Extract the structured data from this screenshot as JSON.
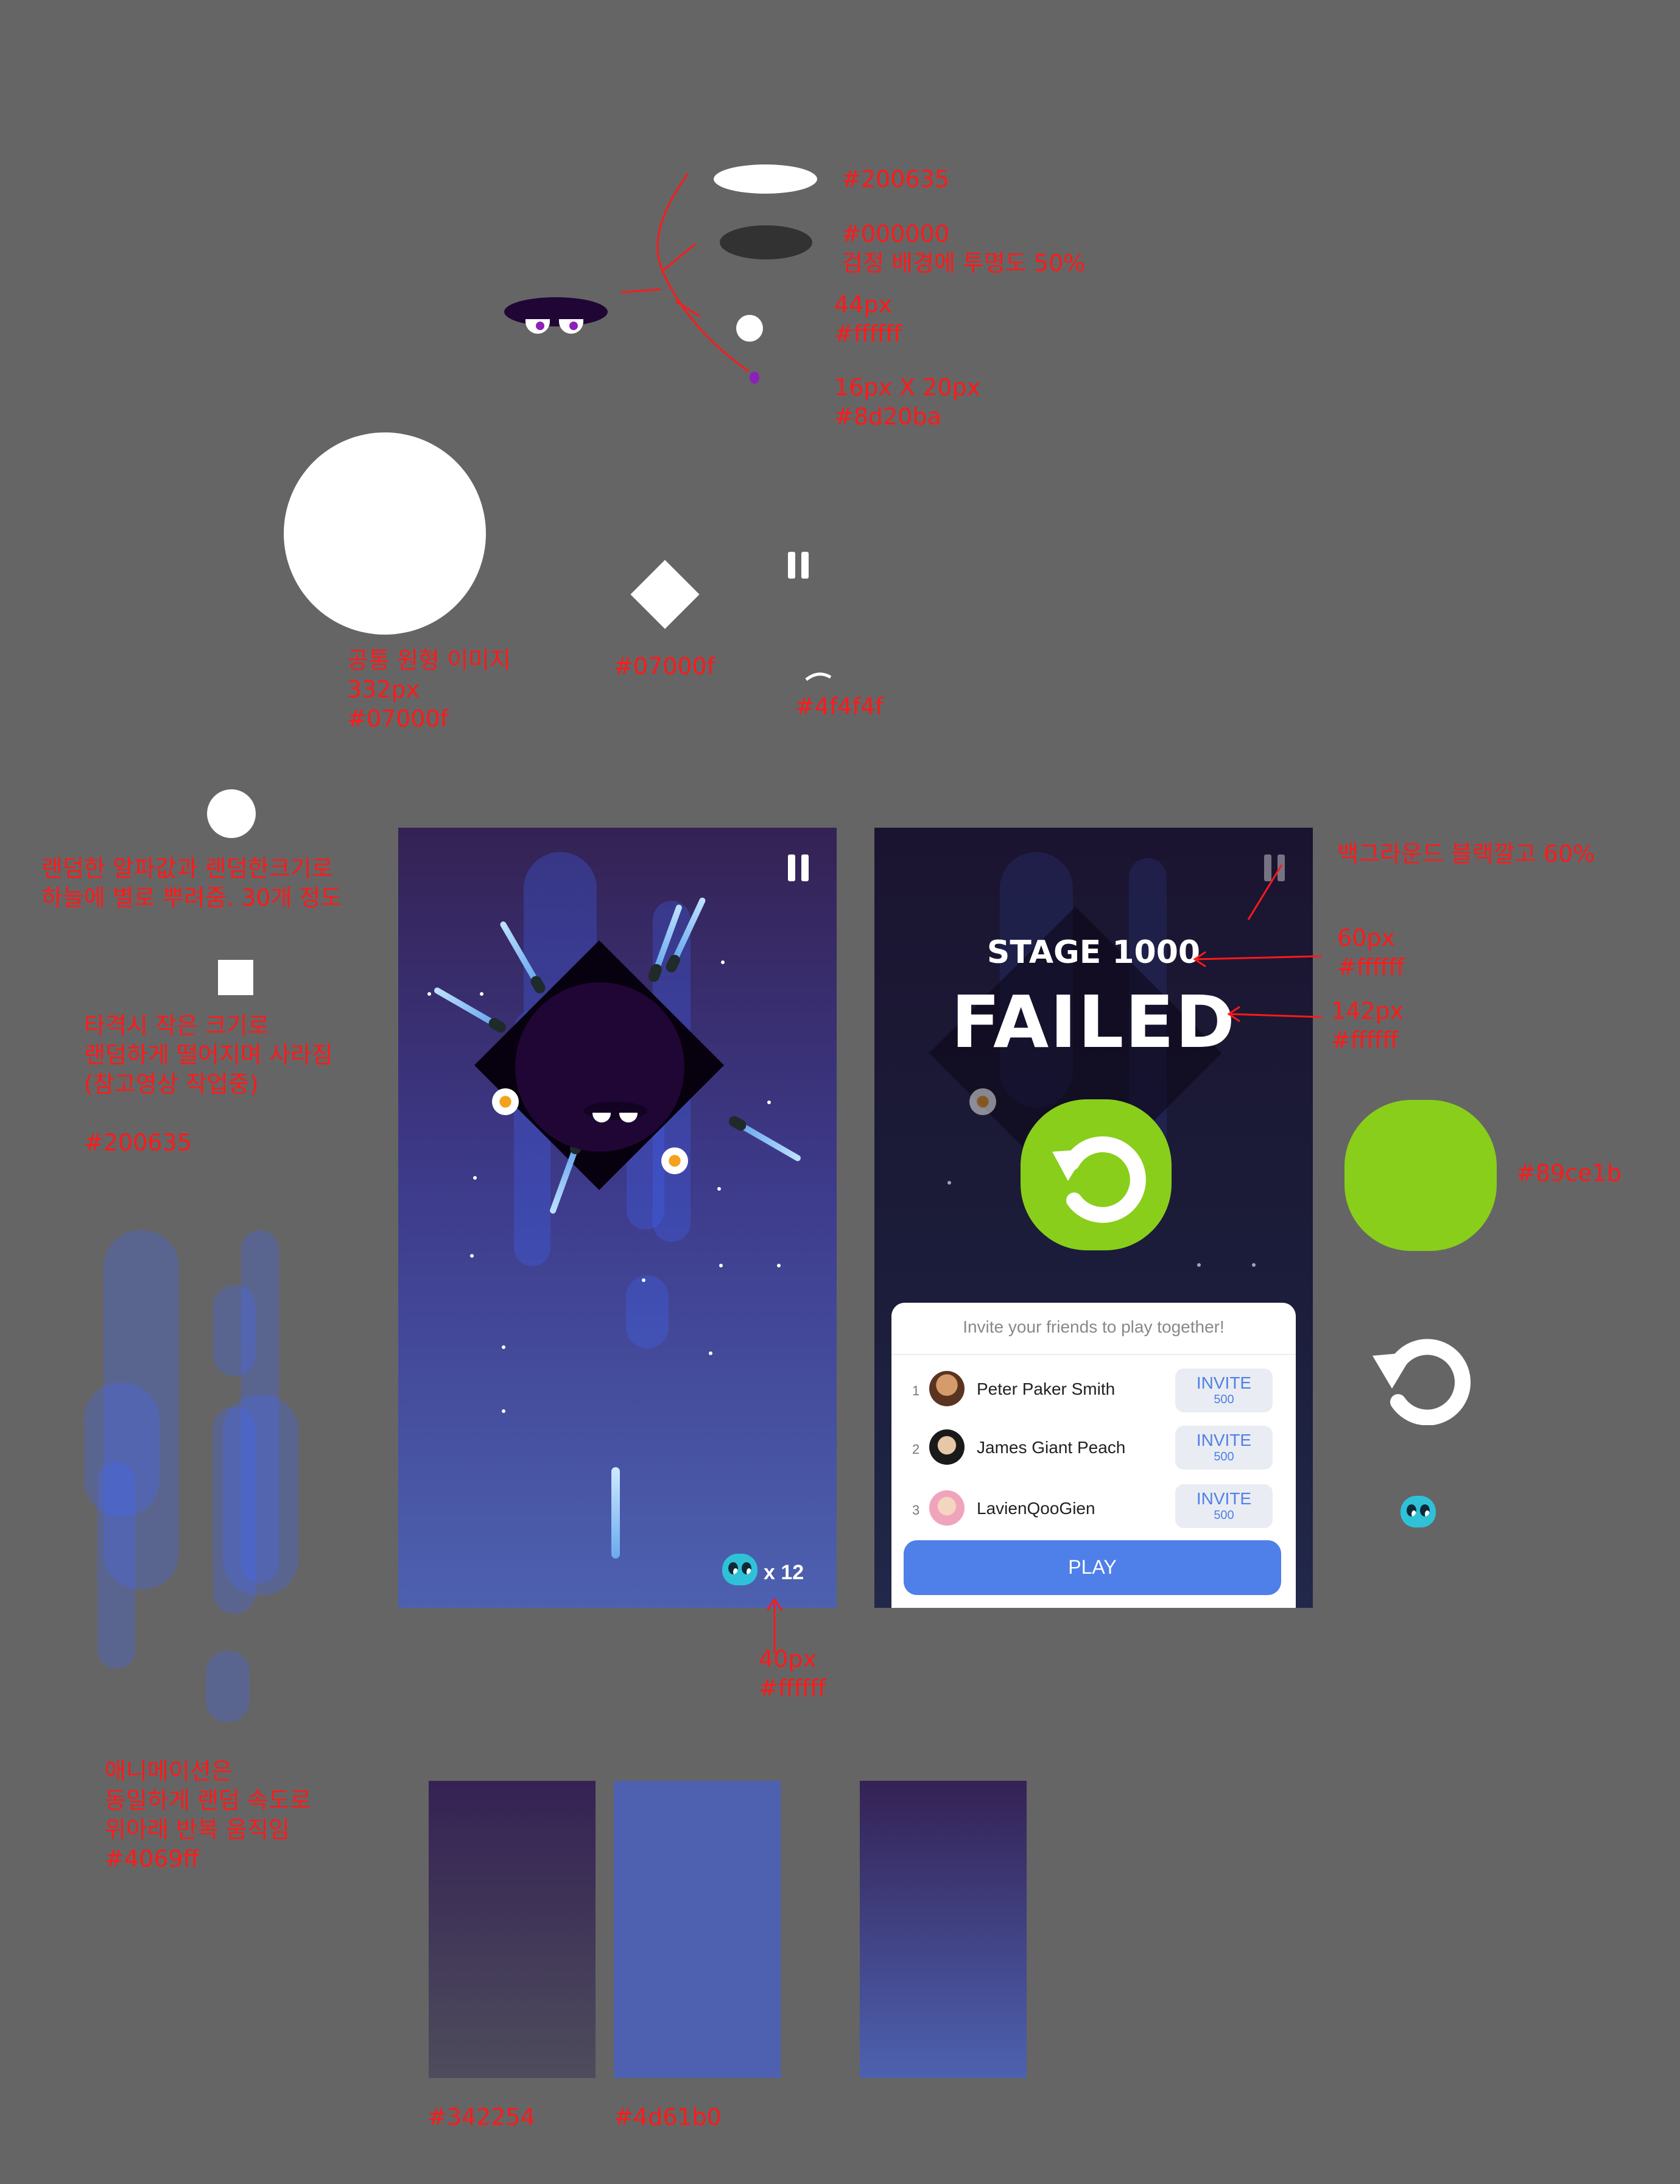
{
  "annotations": {
    "c200635": "#200635",
    "c000000": "#000000",
    "black_bg_opacity": "검정 배경에 투명도 50%",
    "px44": "44px",
    "ffffff_1": "#ffffff",
    "px16x20": "16px X 20px",
    "c8d20ba": "#8d20ba",
    "common_circle": "공통 원형 이미지",
    "px332": "332px",
    "c07000f_1": "#07000f",
    "c07000f_2": "#07000f",
    "c4f4f4f": "#4f4f4f",
    "stars_note_1": "랜덤한 알파값과 랜덤한크기로",
    "stars_note_2": "하늘에 별로 뿌려줌. 30개 정도",
    "hit_note_1": "타격시 작은 크기로",
    "hit_note_2": "랜덤하게 떨어지며 사라짐",
    "hit_note_3": "(참고영상 작업중)",
    "hit_color": "#200635",
    "bg_black_60": "백그라운드 블랙깔고 60%",
    "px60": "60px",
    "ffffff_2": "#ffffff",
    "px142": "142px",
    "ffffff_3": "#ffffff",
    "c89ce1b": "#89ce1b",
    "px40": "40px",
    "ffffff_4": "#ffffff",
    "anim_note_1": "애니메이션은",
    "anim_note_2": "동일하게 랜덤 속도로",
    "anim_note_3": "위아래 반복 움직임",
    "anim_color": "#4069ff",
    "swatch_label_1": "#342254",
    "swatch_label_2": "#4d61b0"
  },
  "game": {
    "lives_count": "x 12"
  },
  "failed_screen": {
    "stage_label": "STAGE 1000",
    "failed_label": "FAILED",
    "invite_title": "Invite your friends to play together!",
    "friends": [
      {
        "rank": "1",
        "name": "Peter Paker Smith",
        "invite": "INVITE",
        "reward": "500"
      },
      {
        "rank": "2",
        "name": "James Giant Peach",
        "invite": "INVITE",
        "reward": "500"
      },
      {
        "rank": "3",
        "name": "LavienQooGien",
        "invite": "INVITE",
        "reward": "500"
      }
    ],
    "play_label": "PLAY"
  },
  "colors": {
    "bg_top": "#342254",
    "bg_bottom": "#4d61b0",
    "green": "#89ce1b",
    "boss": "#200635",
    "shadow": "#07000f"
  }
}
